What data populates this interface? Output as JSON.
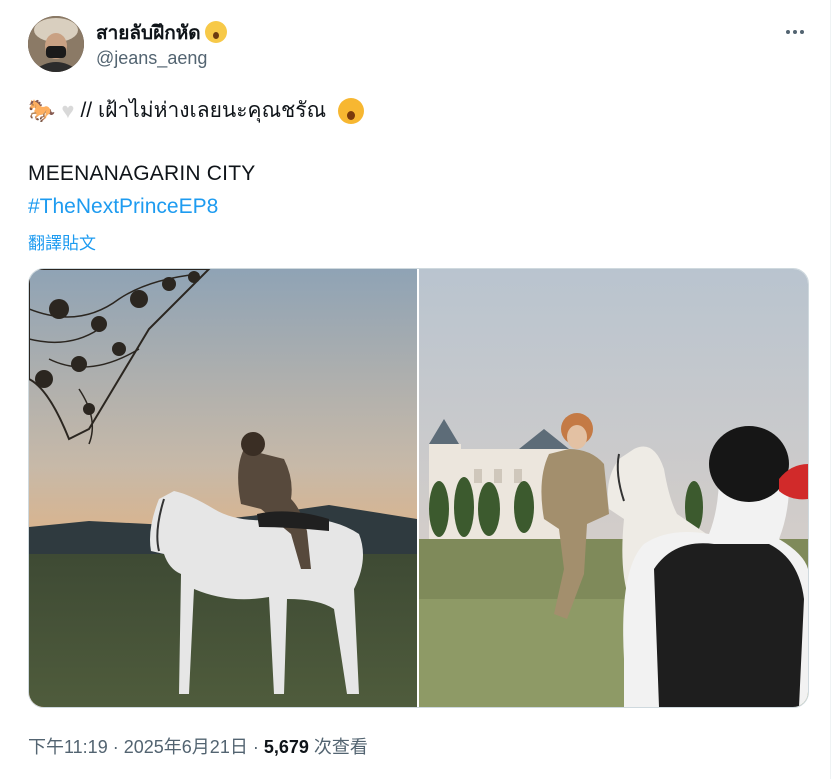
{
  "tweet": {
    "display_name": "สายลับฝึกหัด",
    "handle": "@jeans_aeng",
    "more_icon": "ellipsis-icon",
    "text_line1": "// เฝ้าไม่ห่างเลยนะคุณชรัณ",
    "text_line2": "MEENANAGARIN CITY",
    "hashtag": "#TheNextPrinceEP8",
    "translate_label": "翻譯貼文",
    "emojis": [
      "horse-icon",
      "white-heart-icon",
      "face-with-open-mouth-icon"
    ],
    "time": "下午11:19",
    "date": "2025年6月21日",
    "separator": "·",
    "views_count": "5,679",
    "views_label": "次查看"
  },
  "media": {
    "photos": [
      {
        "name": "sunset-horse-rider-photo"
      },
      {
        "name": "castle-horse-rider-photo"
      }
    ]
  },
  "colors": {
    "link": "#1d9bf0",
    "secondary_text": "#536471",
    "primary_text": "#0f1419",
    "border": "#cfd9de"
  }
}
